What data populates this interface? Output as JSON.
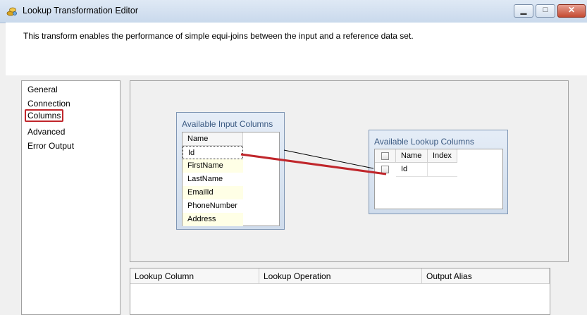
{
  "window": {
    "title": "Lookup Transformation Editor",
    "minimize_glyph": "▁",
    "maximize_glyph": "□",
    "close_glyph": "✕"
  },
  "description": "This transform enables the performance of simple equi-joins between the input and a reference data set.",
  "nav": {
    "items": [
      "General",
      "Connection",
      "Columns",
      "Advanced",
      "Error Output"
    ],
    "selected": "Columns"
  },
  "input_columns": {
    "title": "Available Input Columns",
    "header": "Name",
    "rows": [
      "Id",
      "FirstName",
      "LastName",
      "EmailId",
      "PhoneNumber",
      "Address"
    ]
  },
  "lookup_columns": {
    "title": "Available Lookup Columns",
    "headers": [
      "Name",
      "Index"
    ],
    "rows": [
      {
        "name": "Id",
        "index": "",
        "checked": false
      }
    ]
  },
  "mapping": {
    "from": "Id",
    "to": "Id",
    "highlight_color": "#c0262b"
  },
  "output_grid": {
    "headers": [
      "Lookup Column",
      "Lookup Operation",
      "Output Alias"
    ]
  }
}
